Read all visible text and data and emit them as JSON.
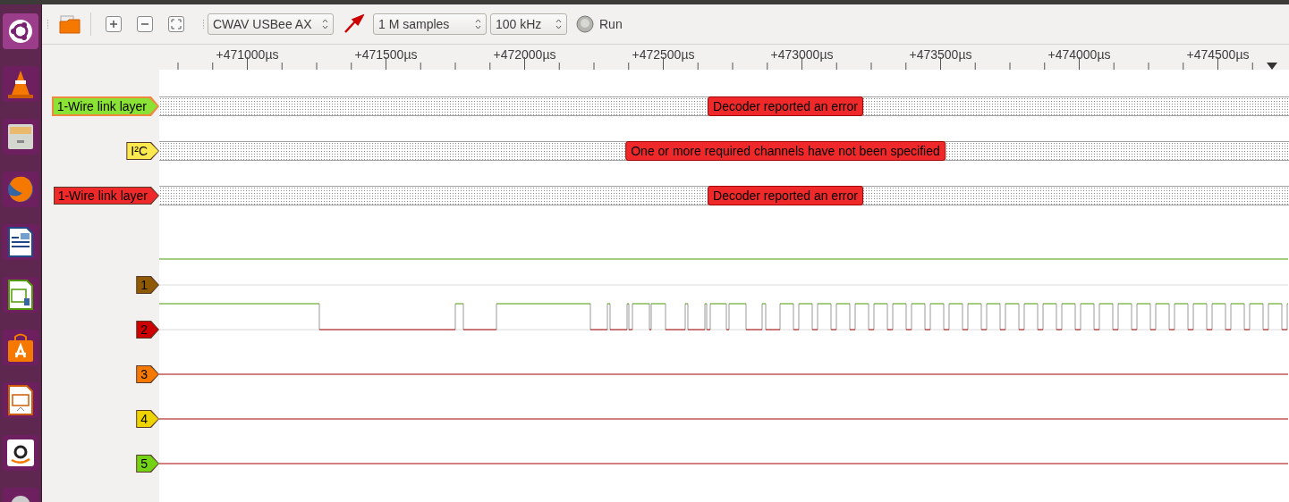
{
  "toolbar": {
    "device": "CWAV USBee AX",
    "samples": "1 M samples",
    "rate": "100 kHz",
    "run": "Run"
  },
  "ruler": {
    "ticks": [
      "+471000µs",
      "+471500µs",
      "+472000µs",
      "+472500µs",
      "+473000µs",
      "+473500µs",
      "+474000µs",
      "+474500µs"
    ]
  },
  "decoders": [
    {
      "label": "1-Wire link layer",
      "color": "#8ae234",
      "selected": true,
      "message": "Decoder reported an error"
    },
    {
      "label": "I²C",
      "color": "#fce94f",
      "selected": false,
      "message": "One or more required channels have not been specified"
    },
    {
      "label": "1-Wire link layer",
      "color": "#ef2929",
      "selected": false,
      "message": "Decoder reported an error"
    }
  ],
  "channels": [
    {
      "label": "1",
      "color": "#8f5902",
      "kind": "high"
    },
    {
      "label": "2",
      "color": "#cc0000",
      "kind": "signal"
    },
    {
      "label": "3",
      "color": "#f57900",
      "kind": "low"
    },
    {
      "label": "4",
      "color": "#edd400",
      "kind": "low"
    },
    {
      "label": "5",
      "color": "#73d216",
      "kind": "low"
    }
  ]
}
